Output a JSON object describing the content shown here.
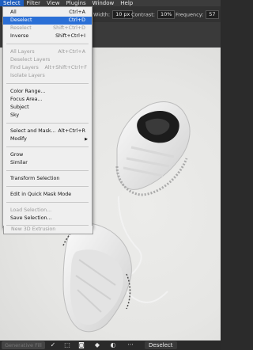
{
  "menubar": {
    "items": [
      "Select",
      "Filter",
      "View",
      "Plugins",
      "Window",
      "Help"
    ]
  },
  "options": {
    "width_label": "Width:",
    "width_value": "10 px",
    "contrast_label": "Contrast:",
    "contrast_value": "10%",
    "frequency_label": "Frequency:",
    "frequency_value": "57"
  },
  "menu": {
    "all": {
      "label": "All",
      "shortcut": "Ctrl+A"
    },
    "deselect": {
      "label": "Deselect",
      "shortcut": "Ctrl+D"
    },
    "reselect": {
      "label": "Reselect",
      "shortcut": "Shift+Ctrl+D"
    },
    "inverse": {
      "label": "Inverse",
      "shortcut": "Shift+Ctrl+I"
    },
    "all_layers": {
      "label": "All Layers",
      "shortcut": "Alt+Ctrl+A"
    },
    "deselect_layers": {
      "label": "Deselect Layers"
    },
    "find_layers": {
      "label": "Find Layers",
      "shortcut": "Alt+Shift+Ctrl+F"
    },
    "isolate_layers": {
      "label": "Isolate Layers"
    },
    "color_range": {
      "label": "Color Range..."
    },
    "focus_area": {
      "label": "Focus Area..."
    },
    "subject": {
      "label": "Subject"
    },
    "sky": {
      "label": "Sky"
    },
    "select_and_mask": {
      "label": "Select and Mask...",
      "shortcut": "Alt+Ctrl+R"
    },
    "modify": {
      "label": "Modify"
    },
    "grow": {
      "label": "Grow"
    },
    "similar": {
      "label": "Similar"
    },
    "transform_selection": {
      "label": "Transform Selection"
    },
    "edit_quick_mask": {
      "label": "Edit in Quick Mask Mode"
    },
    "load_selection": {
      "label": "Load Selection..."
    },
    "save_selection": {
      "label": "Save Selection..."
    },
    "new_3d_extrusion": {
      "label": "New 3D Extrusion"
    }
  },
  "bottom": {
    "generative_fill": "Generative Fill",
    "more": "···",
    "deselect": "Deselect"
  },
  "colors": {
    "highlight": "#2a6fd6",
    "menu_bg": "#efefef"
  }
}
